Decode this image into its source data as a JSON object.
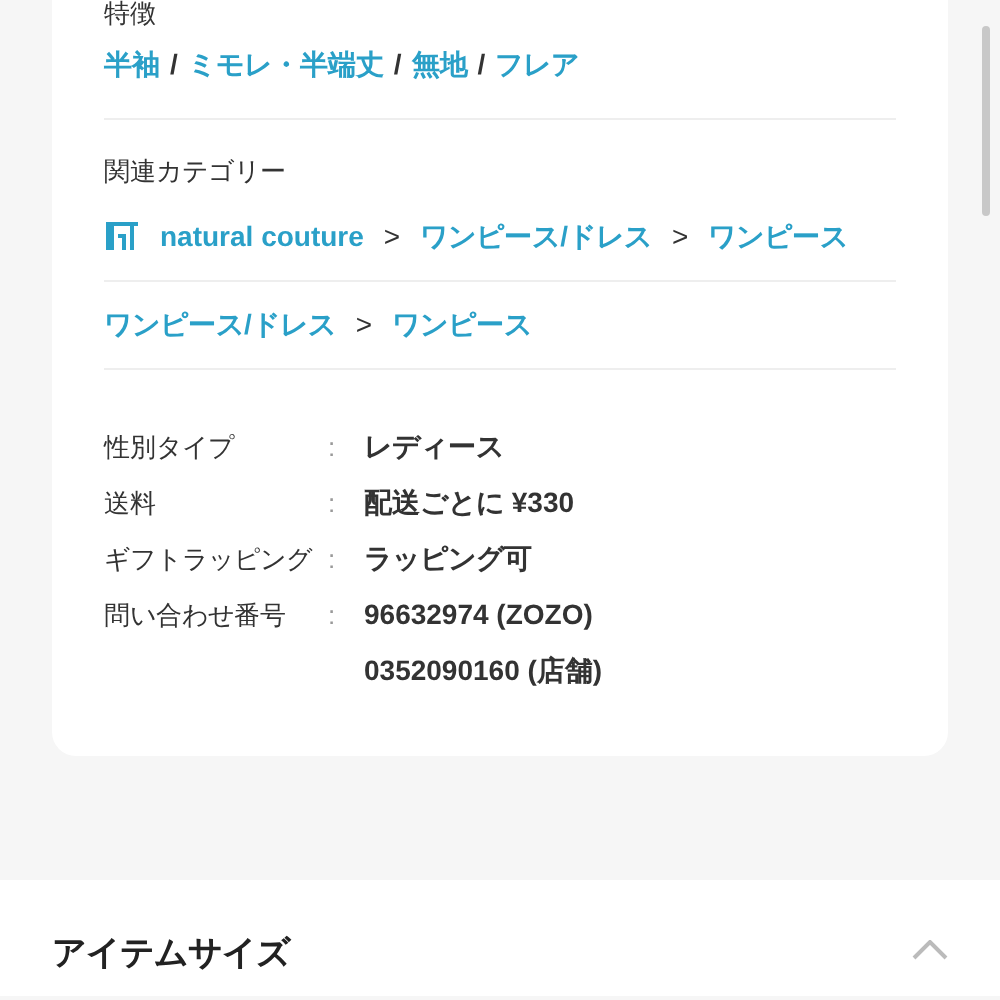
{
  "features": {
    "label": "特徴",
    "separator": "/",
    "items": [
      "半袖",
      "ミモレ・半端丈",
      "無地",
      "フレア"
    ]
  },
  "categories": {
    "label": "関連カテゴリー",
    "separator": ">",
    "rows": [
      {
        "kind": "store",
        "items": [
          "natural couture",
          "ワンピース/ドレス",
          "ワンピース"
        ]
      },
      {
        "kind": "plain",
        "items": [
          "ワンピース/ドレス",
          "ワンピース"
        ]
      }
    ]
  },
  "details": {
    "separator": ":",
    "rows": [
      {
        "label": "性別タイプ",
        "values": [
          "レディース"
        ]
      },
      {
        "label": "送料",
        "values": [
          "配送ごとに ¥330"
        ]
      },
      {
        "label": "ギフトラッピング",
        "values": [
          "ラッピング可"
        ]
      },
      {
        "label": "問い合わせ番号",
        "values": [
          "96632974 (ZOZO)",
          "0352090160 (店舗)"
        ]
      }
    ]
  },
  "section": {
    "title": "アイテムサイズ",
    "expanded": true
  }
}
